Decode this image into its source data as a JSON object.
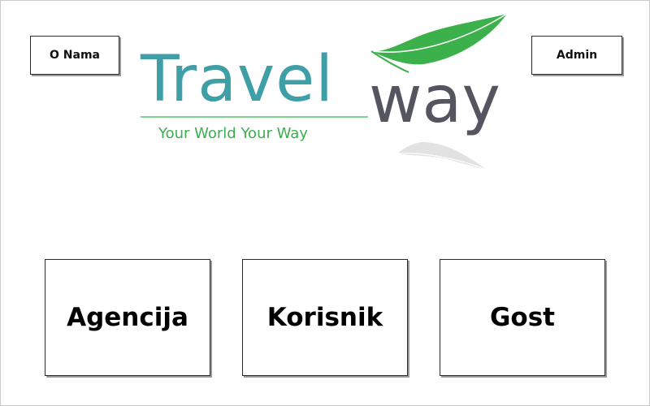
{
  "header": {
    "about_label": "O Nama",
    "admin_label": "Admin"
  },
  "logo": {
    "word1": "Travel",
    "word2": "way",
    "tagline": "Your World Your Way",
    "colors": {
      "travel": "#3f9fa7",
      "way": "#555560",
      "tagline": "#3cae4f",
      "feather": "#3cb04b",
      "feather_shadow": "#e2e2e2"
    },
    "icon": "feather-icon"
  },
  "roles": {
    "agency_label": "Agencija",
    "user_label": "Korisnik",
    "guest_label": "Gost"
  }
}
